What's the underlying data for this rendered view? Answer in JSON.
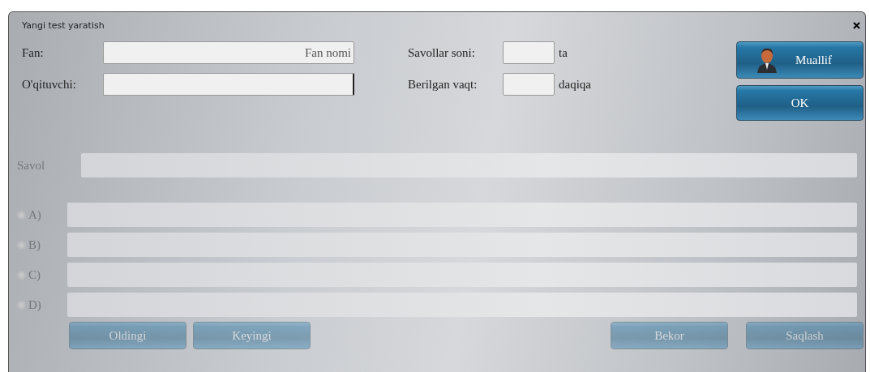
{
  "window": {
    "title": "Yangi test yaratish"
  },
  "fields": [
    {
      "label": "Fan:",
      "placeholder": "Fan nomi",
      "focused": false
    },
    {
      "label": "O'qituvchi:",
      "focused": true
    }
  ],
  "counts": [
    {
      "label": "Savollar soni:",
      "unit": "ta"
    },
    {
      "label": "Berilgan vaqt:",
      "unit": "daqiqa"
    }
  ],
  "side_buttons": [
    {
      "kind": "author",
      "label": "Muallif"
    },
    {
      "kind": "plain",
      "label": "OK"
    }
  ],
  "question": {
    "label": "Savol",
    "disabled": true
  },
  "options": [
    {
      "label": "A)",
      "selected": false,
      "disabled": true
    },
    {
      "label": "B)",
      "selected": false,
      "disabled": true
    },
    {
      "label": "C)",
      "selected": false,
      "disabled": true
    },
    {
      "label": "D)",
      "selected": false,
      "disabled": true
    }
  ],
  "nav_buttons": [
    {
      "label": "Oldingi",
      "disabled": true
    },
    {
      "label": "Keyingi",
      "disabled": true
    }
  ],
  "action_buttons": [
    {
      "label": "Bekor",
      "disabled": true
    },
    {
      "label": "Saqlash",
      "disabled": true
    }
  ]
}
